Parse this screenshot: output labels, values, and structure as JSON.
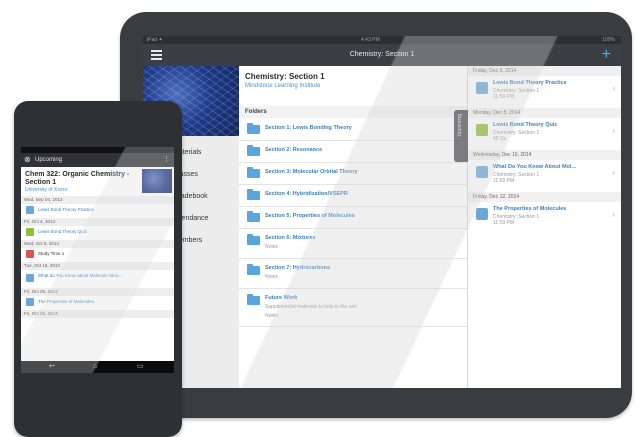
{
  "tablet": {
    "status_left": "iPad ✦",
    "status_time": "4:43 PM",
    "status_right": "100%",
    "nav_title": "Chemistry: Section 1",
    "plus_label": "+",
    "course_title": "Chemistry: Section 1",
    "course_subtitle": "Mindstone Learning Institute",
    "folders_header": "Folders",
    "nav_items": [
      "Materials",
      "Classes",
      "Gradebook",
      "Attendance",
      "Members"
    ],
    "folders": [
      {
        "name": "Section 1: Lewis Bonding Theory",
        "note": ""
      },
      {
        "name": "Section 2: Resonance",
        "note": ""
      },
      {
        "name": "Section 3: Molecular Orbital Theory",
        "note": ""
      },
      {
        "name": "Section 4: Hybridization/VSEPR",
        "note": ""
      },
      {
        "name": "Section 5: Properties of Molecules",
        "note": ""
      },
      {
        "name": "Section 6: Mixtures",
        "note": "Notes"
      },
      {
        "name": "Section 7: Hydrocarbons",
        "note": "Notes"
      },
      {
        "name": "Future Work",
        "note": "Supplemental materials to help in the unit",
        "note2": "Notes"
      }
    ],
    "side_tab": "Upcoming",
    "upcoming": [
      {
        "day": "Friday, Dec 5, 2014",
        "title": "Lewis Bond Theory Practice",
        "sub1": "Chemistry: Section 1",
        "sub2": "11:59 PM",
        "color": "#6aa7d8"
      },
      {
        "day": "Monday, Dec 8, 2014",
        "title": "Lewis Bond Theory Quiz",
        "sub1": "Chemistry: Section 1",
        "sub2": "45 Qs",
        "color": "#8bbf3c"
      },
      {
        "day": "Wednesday, Dec 10, 2014",
        "title": "What Do You Know About Mol...",
        "sub1": "Chemistry: Section 1",
        "sub2": "11:59 PM",
        "color": "#6aa7d8"
      },
      {
        "day": "Friday, Dec 12, 2014",
        "title": "The Properties of Molecules",
        "sub1": "Chemistry: Section 1",
        "sub2": "11:59 PM",
        "color": "#6aa7d8"
      }
    ]
  },
  "phone": {
    "actionbar_title": "Upcoming",
    "course_title": "Chem 322: Organic Chemistry - Section 1",
    "course_subtitle": "University of Xxxxx",
    "items": [
      {
        "day": "Wed, Sep 04, 2013",
        "text": "Lewis Bond Theory Practice",
        "color": "#6aa7d8"
      },
      {
        "day": "Fri, Oct 4, 2013",
        "text": "Lewis Bond Theory Quiz",
        "color": "#8bbf3c"
      },
      {
        "day": "Wed, Oct 9, 2013",
        "text": "Study Time 1",
        "color": "#d9534f"
      },
      {
        "day": "Tue, Oct 15, 2013",
        "text": "What do You Know about Molecule Struc...",
        "color": "#6aa7d8"
      },
      {
        "day": "Fri, Oct 25, 2013",
        "text": "The Properties of Molecules",
        "color": "#6aa7d8"
      },
      {
        "day": "Fri, Oct 25, 2013",
        "text": "",
        "color": "#6aa7d8"
      }
    ],
    "nav_back": "↩",
    "nav_home": "⌂",
    "nav_recent": "▭"
  }
}
